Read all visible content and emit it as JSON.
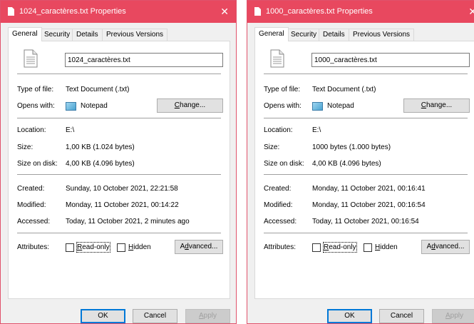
{
  "dialogs": [
    {
      "title": "1024_caractères.txt Properties",
      "close_glyph": "✕",
      "tabs": [
        "General",
        "Security",
        "Details",
        "Previous Versions"
      ],
      "active_tab": "General",
      "file_name": "1024_caractères.txt",
      "type_label": "Type of file:",
      "type_value": "Text Document (.txt)",
      "opens_label": "Opens with:",
      "opens_value": "Notepad",
      "change_pre": "",
      "change_u": "C",
      "change_post": "hange...",
      "location_label": "Location:",
      "location_value": "E:\\",
      "size_label": "Size:",
      "size_value": "1,00 KB (1.024 bytes)",
      "disk_label": "Size on disk:",
      "disk_value": "4,00 KB (4.096 bytes)",
      "created_label": "Created:",
      "created_value": "Sunday, 10 October 2021, 22:21:58",
      "modified_label": "Modified:",
      "modified_value": "Monday, 11 October 2021, 00:14:22",
      "accessed_label": "Accessed:",
      "accessed_value": "Today, 11 October 2021, 2 minutes ago",
      "attributes_label": "Attributes:",
      "readonly_pre": "",
      "readonly_u": "R",
      "readonly_post": "ead-only",
      "hidden_pre": "",
      "hidden_u": "H",
      "hidden_post": "idden",
      "advanced_pre": "A",
      "advanced_u": "d",
      "advanced_post": "vanced...",
      "ok_label": "OK",
      "cancel_label": "Cancel",
      "apply_pre": "",
      "apply_u": "A",
      "apply_post": "pply"
    },
    {
      "title": "1000_caractères.txt Properties",
      "close_glyph": "✕",
      "tabs": [
        "General",
        "Security",
        "Details",
        "Previous Versions"
      ],
      "active_tab": "General",
      "file_name": "1000_caractères.txt",
      "type_label": "Type of file:",
      "type_value": "Text Document (.txt)",
      "opens_label": "Opens with:",
      "opens_value": "Notepad",
      "change_pre": "",
      "change_u": "C",
      "change_post": "hange...",
      "location_label": "Location:",
      "location_value": "E:\\",
      "size_label": "Size:",
      "size_value": "1000 bytes (1.000 bytes)",
      "disk_label": "Size on disk:",
      "disk_value": "4,00 KB (4.096 bytes)",
      "created_label": "Created:",
      "created_value": "Monday, 11 October 2021, 00:16:41",
      "modified_label": "Modified:",
      "modified_value": "Monday, 11 October 2021, 00:16:54",
      "accessed_label": "Accessed:",
      "accessed_value": "Today, 11 October 2021, 00:16:54",
      "attributes_label": "Attributes:",
      "readonly_pre": "",
      "readonly_u": "R",
      "readonly_post": "ead-only",
      "hidden_pre": "",
      "hidden_u": "H",
      "hidden_post": "idden",
      "advanced_pre": "A",
      "advanced_u": "d",
      "advanced_post": "vanced...",
      "ok_label": "OK",
      "cancel_label": "Cancel",
      "apply_pre": "",
      "apply_u": "A",
      "apply_post": "pply"
    }
  ],
  "colors": {
    "title_bar": "#e8485f",
    "dialog_bg": "#f0f0f0",
    "panel_bg": "#ffffff",
    "default_button_border": "#0078d7"
  }
}
